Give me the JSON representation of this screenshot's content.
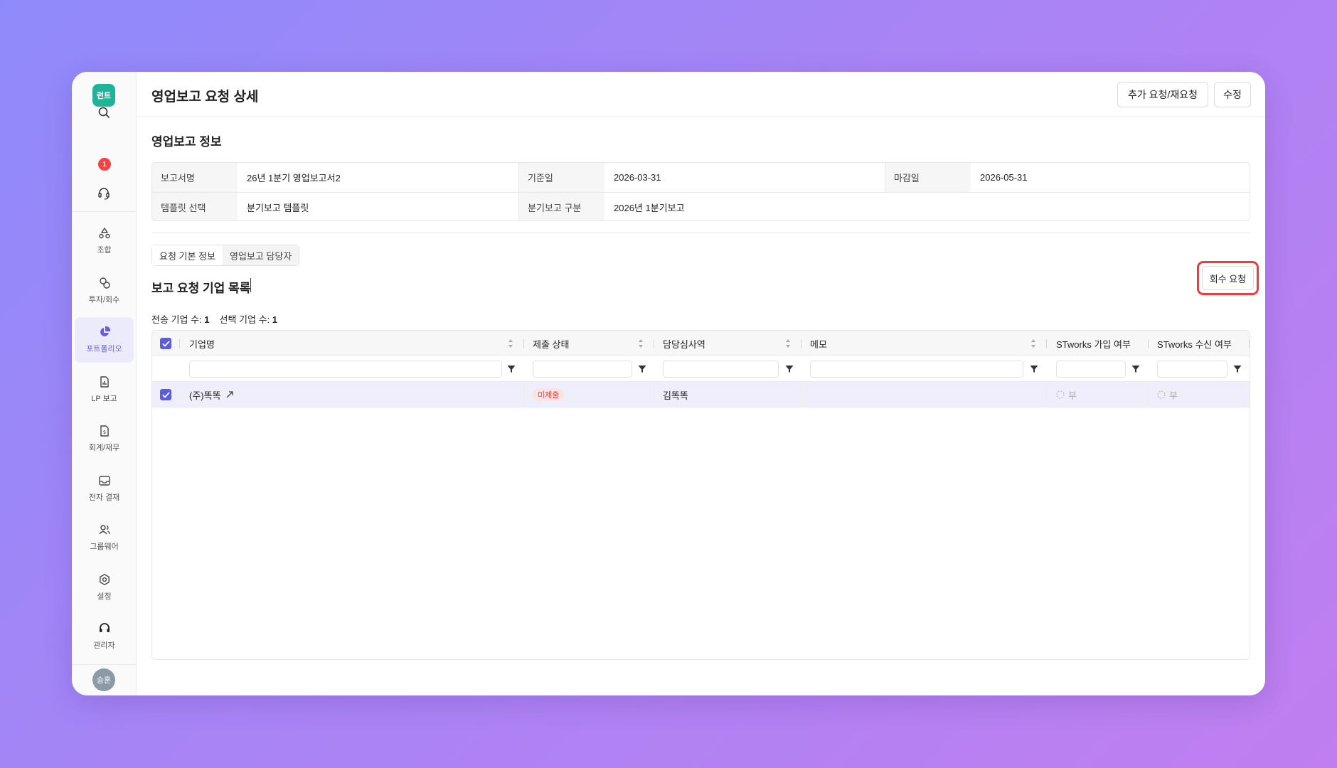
{
  "app": {
    "logo_text": "런트"
  },
  "sidebar": {
    "badge_count": "1",
    "items": [
      {
        "label": "조합",
        "icon": "recycle-icon"
      },
      {
        "label": "투자/회수",
        "icon": "investment-icon"
      },
      {
        "label": "포트폴리오",
        "icon": "pie-chart-icon",
        "active": true
      },
      {
        "label": "LP 보고",
        "icon": "report-file-icon"
      },
      {
        "label": "회계/재무",
        "icon": "finance-file-icon"
      },
      {
        "label": "전자 결재",
        "icon": "inbox-icon"
      },
      {
        "label": "그룹웨어",
        "icon": "users-icon"
      },
      {
        "label": "설정",
        "icon": "gear-icon"
      },
      {
        "label": "관리자",
        "icon": "admin-headset-icon"
      }
    ],
    "avatar_text": "승훈"
  },
  "header": {
    "title": "영업보고 요청 상세",
    "btn_request": "추가 요청/재요청",
    "btn_edit": "수정"
  },
  "info": {
    "section_title": "영업보고 정보",
    "rows": [
      [
        {
          "label": "보고서명",
          "value": "26년 1분기 영업보고서2"
        },
        {
          "label": "기준일",
          "value": "2026-03-31"
        },
        {
          "label": "마감일",
          "value": "2026-05-31"
        }
      ],
      [
        {
          "label": "템플릿 선택",
          "value": "분기보고 템플릿"
        },
        {
          "label": "분기보고 구분",
          "value": "2026년 1분기보고"
        }
      ]
    ]
  },
  "tabs": [
    "요청 기본 정보",
    "영업보고 담당자"
  ],
  "list": {
    "title": "보고 요청 기업 목록",
    "recall_button": "회수 요청",
    "sent_label": "전송 기업 수:",
    "sent_count": "1",
    "selected_label": "선택 기업 수:",
    "selected_count": "1"
  },
  "grid": {
    "columns": [
      "기업명",
      "제출 상태",
      "담당심사역",
      "메모",
      "STworks 가입 여부",
      "STworks 수신 여부"
    ],
    "rows": [
      {
        "company": "(주)똑똑",
        "status": "미제출",
        "reviewer": "김똑똑",
        "memo": "",
        "joined": "부",
        "received": "부"
      }
    ]
  },
  "colors": {
    "accent": "#5b5ce6",
    "logo": "#1fb39a",
    "highlight": "#ef3b3b",
    "status_bg": "#fde3e3",
    "status_fg": "#d94545"
  }
}
